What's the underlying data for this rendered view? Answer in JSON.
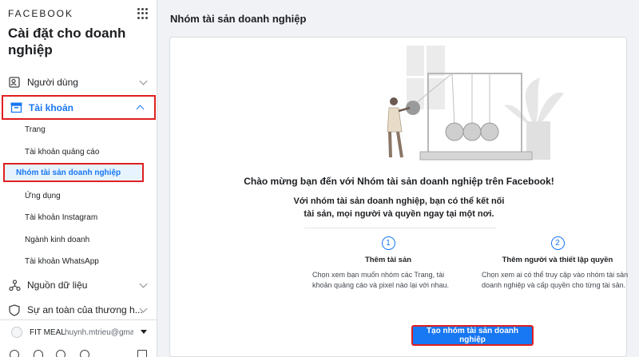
{
  "sidebar": {
    "brand": "FACEBOOK",
    "title": "Cài đặt cho doanh nghiệp",
    "nav": [
      {
        "label": "Người dùng",
        "icon": "users-icon"
      },
      {
        "label": "Tài khoản",
        "icon": "account-icon",
        "expanded": true
      },
      {
        "label": "Nguồn dữ liệu",
        "icon": "data-sources-icon"
      },
      {
        "label": "Sự an toàn của thương h...",
        "icon": "brand-safety-icon"
      }
    ],
    "account_items": [
      "Trang",
      "Tài khoản quảng cáo",
      "Nhóm tài sản doanh nghiệp",
      "Ứng dụng",
      "Tài khoản Instagram",
      "Ngành kinh doanh",
      "Tài khoản WhatsApp"
    ],
    "active_item": "Nhóm tài sản doanh nghiệp",
    "footer": {
      "business_name": "FIT MEAL",
      "email": "huynh.mtrieu@gma..."
    }
  },
  "main": {
    "title": "Nhóm tài sản doanh nghiệp",
    "welcome": "Chào mừng bạn đến với Nhóm tài sản doanh nghiệp trên Facebook!",
    "desc_line1": "Với nhóm tài sản doanh nghiệp, bạn có thể kết nối",
    "desc_line2": "tài sản, mọi người và quyền ngay tại một nơi.",
    "steps": [
      {
        "number": "1",
        "title": "Thêm tài sản",
        "desc": "Chọn xem bạn muốn nhóm các Trang, tài khoản quảng cáo và pixel nào lại với nhau."
      },
      {
        "number": "2",
        "title": "Thêm người và thiết lập quyền",
        "desc": "Chọn xem ai có thể truy cập vào nhóm tài sản doanh nghiệp và cấp quyền cho từng tài sản."
      }
    ],
    "create_button": "Tạo nhóm tài sản doanh nghiệp"
  },
  "colors": {
    "accent": "#1877f2",
    "highlight": "#e02020",
    "background": "#f0f2f5"
  }
}
